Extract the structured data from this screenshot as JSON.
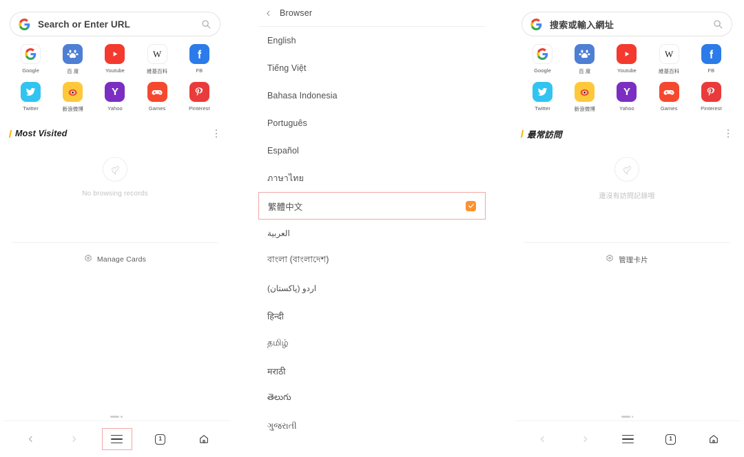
{
  "meta": {
    "accent_orange": "#fb9332",
    "accent_yellow": "#f7b500",
    "highlight_red": "#f2a7a7"
  },
  "home_left": {
    "search": {
      "engine_icon": "google-g-icon",
      "placeholder": "Search or Enter URL",
      "search_icon": "search-icon"
    },
    "shortcuts": [
      {
        "label": "Google",
        "icon": "google-icon"
      },
      {
        "label": "百 度",
        "icon": "baidu-icon"
      },
      {
        "label": "Youtube",
        "icon": "youtube-icon"
      },
      {
        "label": "維基百科",
        "icon": "wikipedia-icon"
      },
      {
        "label": "FB",
        "icon": "facebook-icon"
      },
      {
        "label": "Twitter",
        "icon": "twitter-icon"
      },
      {
        "label": "新浪微博",
        "icon": "weibo-icon"
      },
      {
        "label": "Yahoo",
        "icon": "yahoo-icon"
      },
      {
        "label": "Games",
        "icon": "games-icon"
      },
      {
        "label": "Pinterest",
        "icon": "pinterest-icon"
      }
    ],
    "section": {
      "title": "Most Visited",
      "overflow_icon": "more-vertical-icon"
    },
    "empty": {
      "icon": "heart-icon",
      "text": "No browsing records"
    },
    "manage": {
      "icon": "hexagon-target-icon",
      "label": "Manage Cards"
    },
    "nav": [
      {
        "name": "back",
        "icon": "chevron-left-icon",
        "label": ""
      },
      {
        "name": "forward",
        "icon": "chevron-right-icon",
        "label": ""
      },
      {
        "name": "menu",
        "icon": "hamburger-icon",
        "label": "",
        "highlighted": true
      },
      {
        "name": "tabs",
        "icon": "tab-count-icon",
        "label": "1"
      },
      {
        "name": "home",
        "icon": "home-icon",
        "label": ""
      }
    ]
  },
  "language_panel": {
    "header": {
      "back_icon": "chevron-left-icon",
      "title": "Browser"
    },
    "items": [
      {
        "label": "English",
        "selected": false,
        "rtl": false
      },
      {
        "label": "Tiếng Việt",
        "selected": false,
        "rtl": false
      },
      {
        "label": "Bahasa Indonesia",
        "selected": false,
        "rtl": false
      },
      {
        "label": "Português",
        "selected": false,
        "rtl": false
      },
      {
        "label": "Español",
        "selected": false,
        "rtl": false
      },
      {
        "label": "ภาษาไทย",
        "selected": false,
        "rtl": false
      },
      {
        "label": "繁體中文",
        "selected": true,
        "rtl": false
      },
      {
        "label": "العربية",
        "selected": false,
        "rtl": true
      },
      {
        "label": "বাংলা (বাংলাদেশ)",
        "selected": false,
        "rtl": false
      },
      {
        "label": "اردو (پاکستان)",
        "selected": false,
        "rtl": true
      },
      {
        "label": "हिन्दी",
        "selected": false,
        "rtl": false
      },
      {
        "label": "தமிழ்",
        "selected": false,
        "rtl": false
      },
      {
        "label": "मराठी",
        "selected": false,
        "rtl": false
      },
      {
        "label": "తెలుగు",
        "selected": false,
        "rtl": false
      },
      {
        "label": "ગુજરાતી",
        "selected": false,
        "rtl": false
      }
    ],
    "check_icon": "checkmark-icon"
  },
  "home_right": {
    "search": {
      "engine_icon": "google-g-icon",
      "placeholder": "搜索或輸入網址",
      "search_icon": "search-icon"
    },
    "shortcuts": [
      {
        "label": "Google",
        "icon": "google-icon"
      },
      {
        "label": "百 度",
        "icon": "baidu-icon"
      },
      {
        "label": "Youtube",
        "icon": "youtube-icon"
      },
      {
        "label": "維基百科",
        "icon": "wikipedia-icon"
      },
      {
        "label": "FB",
        "icon": "facebook-icon"
      },
      {
        "label": "Twitter",
        "icon": "twitter-icon"
      },
      {
        "label": "新浪微博",
        "icon": "weibo-icon"
      },
      {
        "label": "Yahoo",
        "icon": "yahoo-icon"
      },
      {
        "label": "Games",
        "icon": "games-icon"
      },
      {
        "label": "Pinterest",
        "icon": "pinterest-icon"
      }
    ],
    "section": {
      "title": "最常訪問",
      "overflow_icon": "more-vertical-icon"
    },
    "empty": {
      "icon": "heart-icon",
      "text": "還沒有訪問記錄哦"
    },
    "manage": {
      "icon": "hexagon-target-icon",
      "label": "管理卡片"
    },
    "nav": [
      {
        "name": "back",
        "icon": "chevron-left-icon",
        "label": ""
      },
      {
        "name": "forward",
        "icon": "chevron-right-icon",
        "label": ""
      },
      {
        "name": "menu",
        "icon": "hamburger-icon",
        "label": "",
        "highlighted": false
      },
      {
        "name": "tabs",
        "icon": "tab-count-icon",
        "label": "1"
      },
      {
        "name": "home",
        "icon": "home-icon",
        "label": ""
      }
    ]
  }
}
